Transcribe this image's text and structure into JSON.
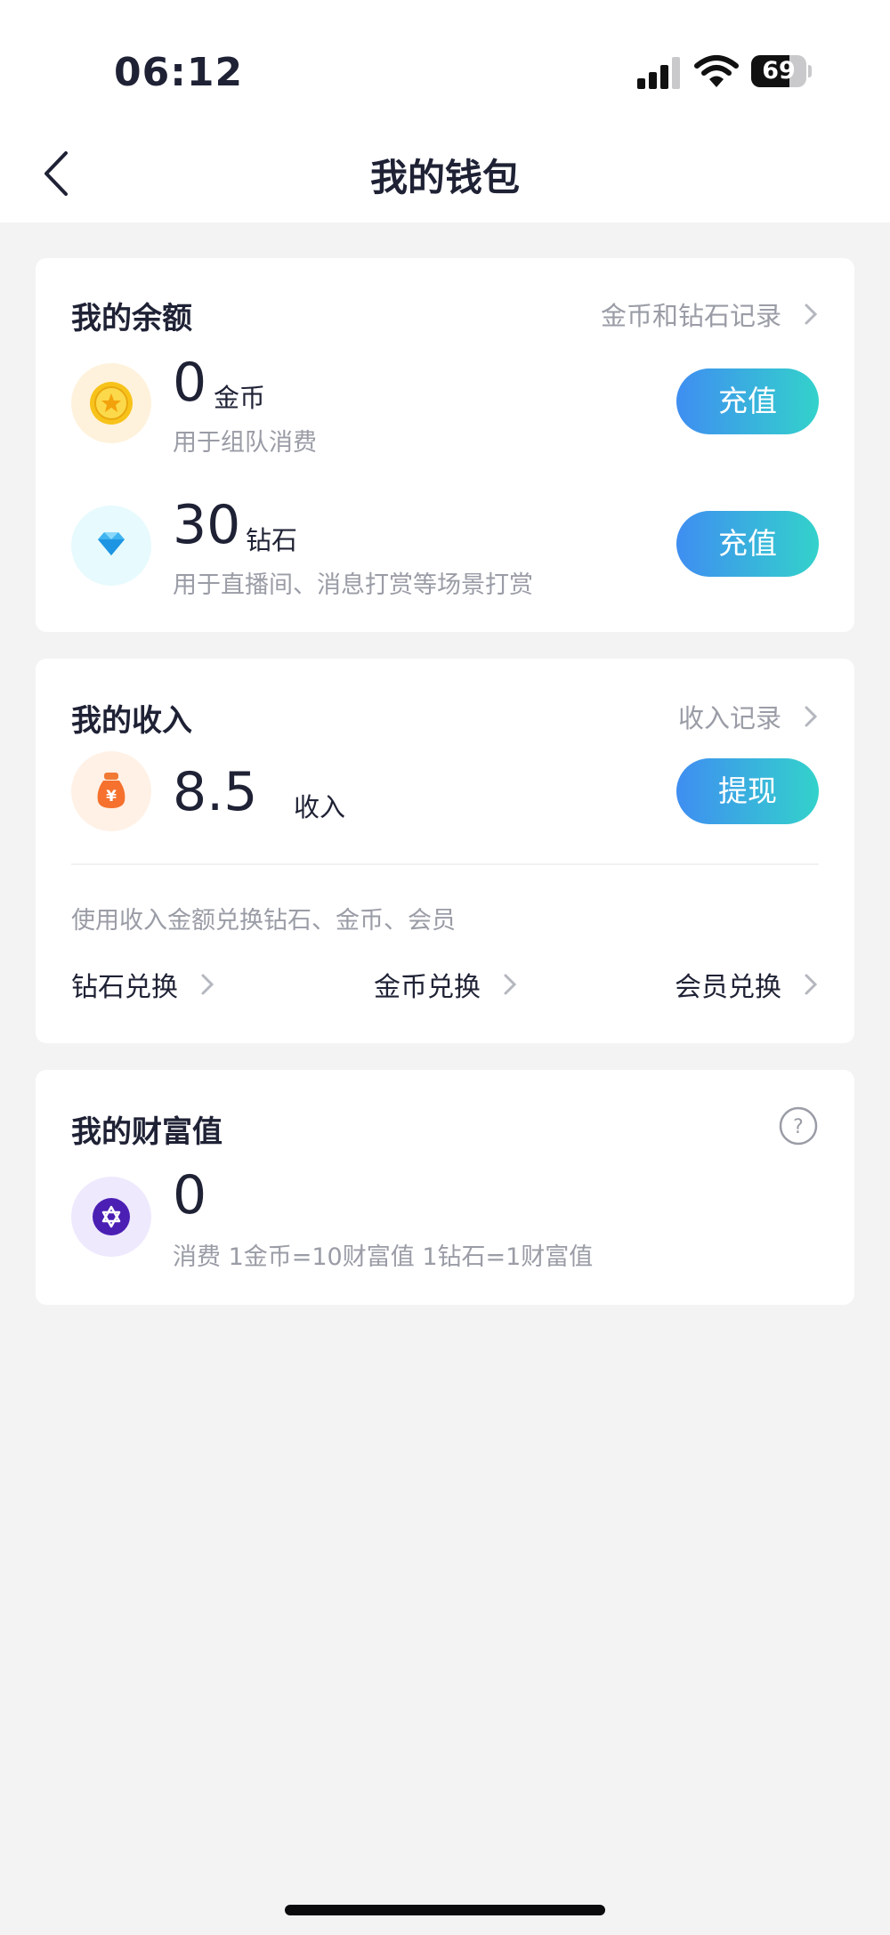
{
  "status_bar": {
    "time": "06:12",
    "battery": "69"
  },
  "header": {
    "title": "我的钱包"
  },
  "balance": {
    "title": "我的余额",
    "record_link": "金币和钻石记录",
    "coin": {
      "amount": "0",
      "unit": "金币",
      "desc": "用于组队消费",
      "button": "充值"
    },
    "diamond": {
      "amount": "30",
      "unit": "钻石",
      "desc": "用于直播间、消息打赏等场景打赏",
      "button": "充值"
    }
  },
  "income": {
    "title": "我的收入",
    "record_link": "收入记录",
    "amount": "8.5",
    "unit": "收入",
    "button": "提现",
    "exchange_note": "使用收入金额兑换钻石、金币、会员",
    "exchanges": [
      "钻石兑换",
      "金币兑换",
      "会员兑换"
    ]
  },
  "wealth": {
    "title": "我的财富值",
    "amount": "0",
    "desc": "消费 1金币=10财富值 1钻石=1财富值"
  },
  "colors": {
    "accent_start": "#3f8ef1",
    "accent_end": "#33d2cb",
    "background": "#f3f3f4",
    "muted_text": "#9a9ca6"
  }
}
